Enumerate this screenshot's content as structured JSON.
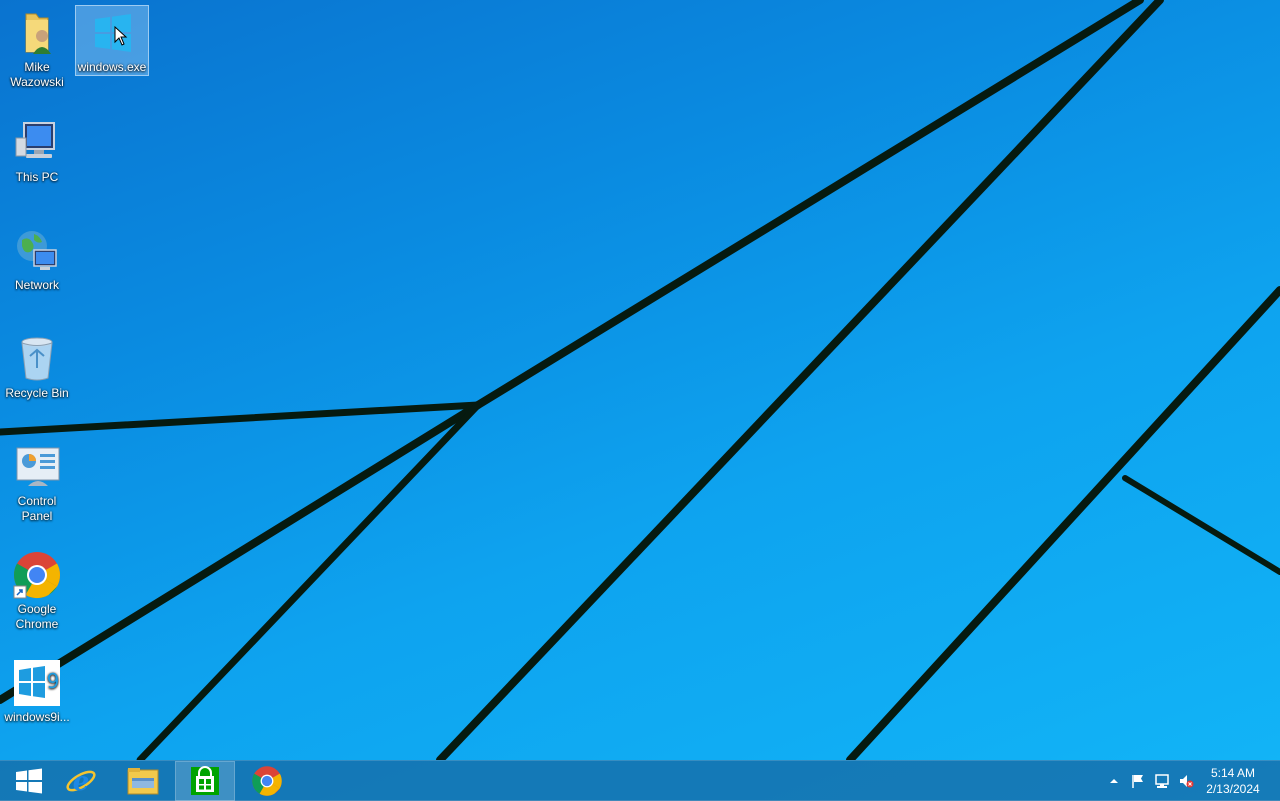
{
  "desktop": {
    "icons": [
      {
        "label": "Mike Wazowski",
        "icon": "user-folder-icon"
      },
      {
        "label": "windows.exe",
        "icon": "windows-logo-icon",
        "selected": true
      },
      {
        "label": "This PC",
        "icon": "computer-icon"
      },
      {
        "label": "Network",
        "icon": "network-icon"
      },
      {
        "label": "Recycle Bin",
        "icon": "recycle-bin-icon"
      },
      {
        "label": "Control Panel",
        "icon": "control-panel-icon"
      },
      {
        "label": "Google Chrome",
        "icon": "chrome-icon"
      },
      {
        "label": "windows9i...",
        "icon": "windows9-icon"
      }
    ]
  },
  "taskbar": {
    "buttons": [
      {
        "name": "start",
        "icon": "windows-start-icon"
      },
      {
        "name": "internet-explorer",
        "icon": "ie-icon"
      },
      {
        "name": "file-explorer",
        "icon": "file-explorer-icon"
      },
      {
        "name": "store",
        "icon": "store-icon",
        "active": true
      },
      {
        "name": "chrome",
        "icon": "chrome-icon"
      }
    ],
    "tray": {
      "icons": [
        "show-hidden-icons-arrow",
        "action-center-flag-icon",
        "network-icon",
        "volume-muted-icon"
      ],
      "time": "5:14 AM",
      "date": "2/13/2024"
    }
  },
  "colors": {
    "wallpaper": "#0ea3ef",
    "taskbar": "#166eaa",
    "accent": "#0a8ae0"
  }
}
